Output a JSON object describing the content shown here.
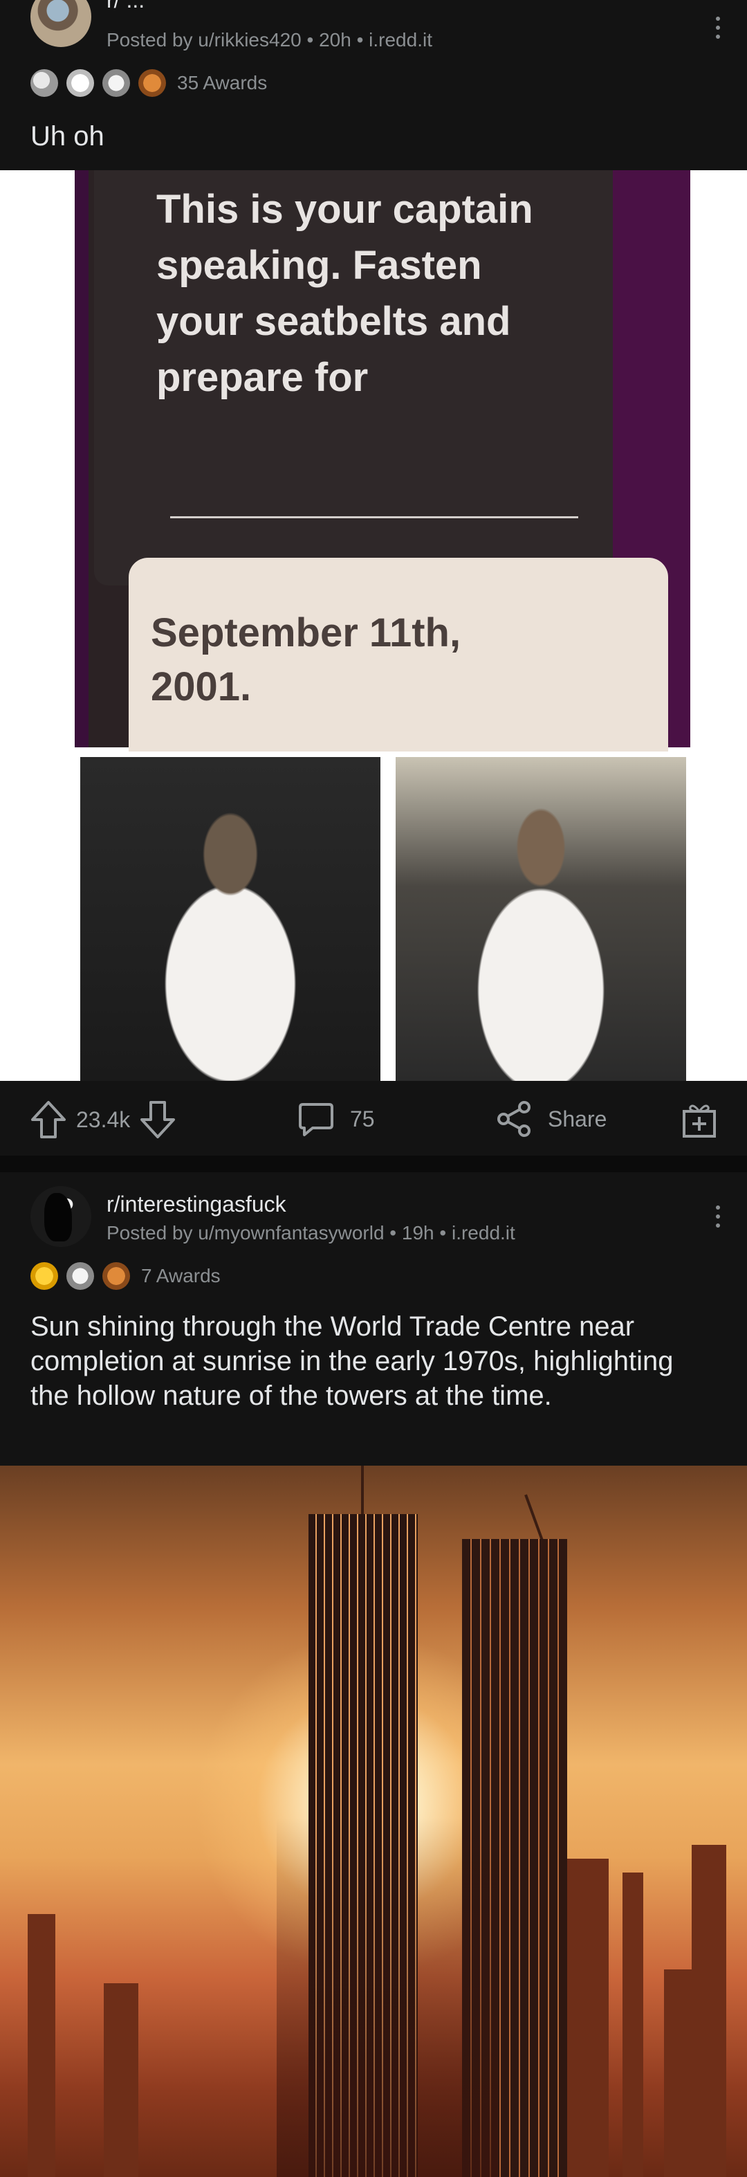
{
  "post1": {
    "subreddit": "r/ ...",
    "byline": "Posted by u/rikkies420 • 20h • i.redd.it",
    "awards_label": "35 Awards",
    "title": "Uh oh",
    "card_text": "This is your captain speaking. Fasten your seatbelts and prepare for",
    "card_answer_line1": "September 11th,",
    "card_answer_line2": "2001.",
    "upvotes": "23.4k",
    "comments": "75",
    "share_label": "Share"
  },
  "post2": {
    "subreddit": "r/interestingasfuck",
    "byline": "Posted by u/myownfantasyworld • 19h • i.redd.it",
    "awards_label": "7 Awards",
    "title": "Sun shining through the World Trade Centre near completion at sunrise in the early 1970s, highlighting the hollow nature of the towers at the time."
  },
  "icons": {
    "upvote": "upvote-arrow-icon",
    "downvote": "downvote-arrow-icon",
    "comment": "comment-bubble-icon",
    "share": "share-icon",
    "award": "gift-award-icon",
    "more": "more-options-icon"
  },
  "colors": {
    "background": "#0b0b0b",
    "post_background": "#131313",
    "text_primary": "#e4e6e8",
    "text_secondary": "#8b8f92"
  }
}
